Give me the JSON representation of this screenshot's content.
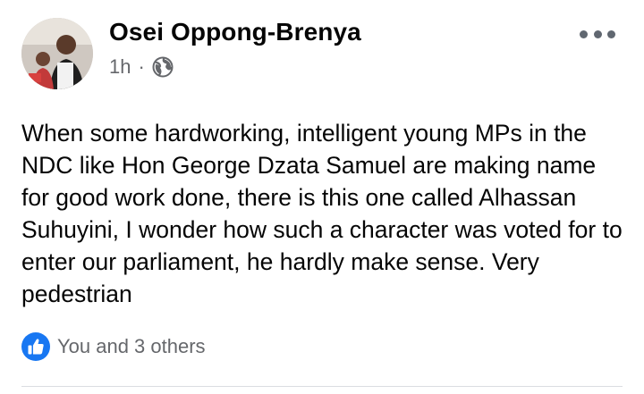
{
  "post": {
    "author": "Osei Oppong-Brenya",
    "time": "1h",
    "separator": "·",
    "privacy_icon": "globe-icon",
    "text": "When some hardworking, intelligent young MPs in the NDC like Hon George Dzata Samuel are making name for good work done, there is this one called Alhassan Suhuyini, I wonder how such a character was voted for to enter our parliament, he hardly make sense. Very pedestrian",
    "more_icon": "more-options-icon"
  },
  "reactions": {
    "icon": "like-icon",
    "summary": "You and 3 others"
  },
  "colors": {
    "text_primary": "#050505",
    "text_secondary": "#65676b",
    "like_blue": "#1877f2",
    "divider": "#dadde1"
  }
}
